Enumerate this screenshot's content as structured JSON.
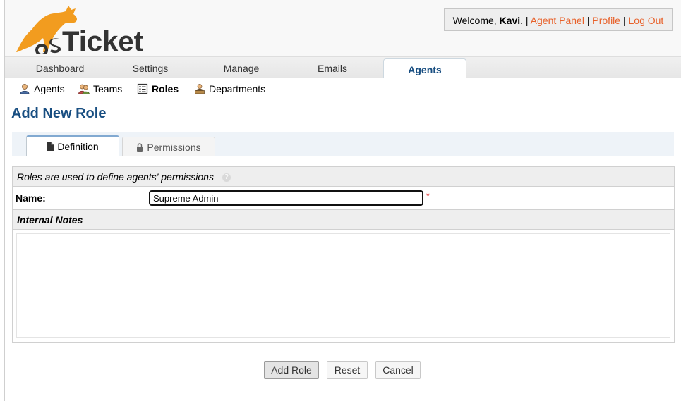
{
  "header": {
    "logo_text": "osTicket",
    "welcome_prefix": "Welcome,",
    "user_name": "Kavi",
    "welcome_dot": ".",
    "links": [
      "Agent Panel",
      "Profile",
      "Log Out"
    ],
    "separator": "|"
  },
  "nav": {
    "tabs": [
      {
        "label": "Dashboard",
        "active": false
      },
      {
        "label": "Settings",
        "active": false
      },
      {
        "label": "Manage",
        "active": false
      },
      {
        "label": "Emails",
        "active": false
      },
      {
        "label": "Agents",
        "active": true
      }
    ]
  },
  "subnav": {
    "items": [
      {
        "label": "Agents",
        "icon": "agent-icon"
      },
      {
        "label": "Teams",
        "icon": "teams-icon"
      },
      {
        "label": "Roles",
        "icon": "roles-icon",
        "active": true
      },
      {
        "label": "Departments",
        "icon": "departments-icon"
      }
    ]
  },
  "page": {
    "title": "Add New Role"
  },
  "form_tabs": {
    "definition": "Definition",
    "permissions": "Permissions"
  },
  "form": {
    "intro": "Roles are used to define agents' permissions",
    "help_symbol": "?",
    "name_label": "Name:",
    "name_value": "Supreme Admin",
    "required_mark": "*",
    "notes_heading": "Internal Notes",
    "notes_value": ""
  },
  "buttons": {
    "add": "Add Role",
    "reset": "Reset",
    "cancel": "Cancel"
  },
  "colors": {
    "brand_orange": "#e8612a",
    "title_blue": "#184e81"
  }
}
